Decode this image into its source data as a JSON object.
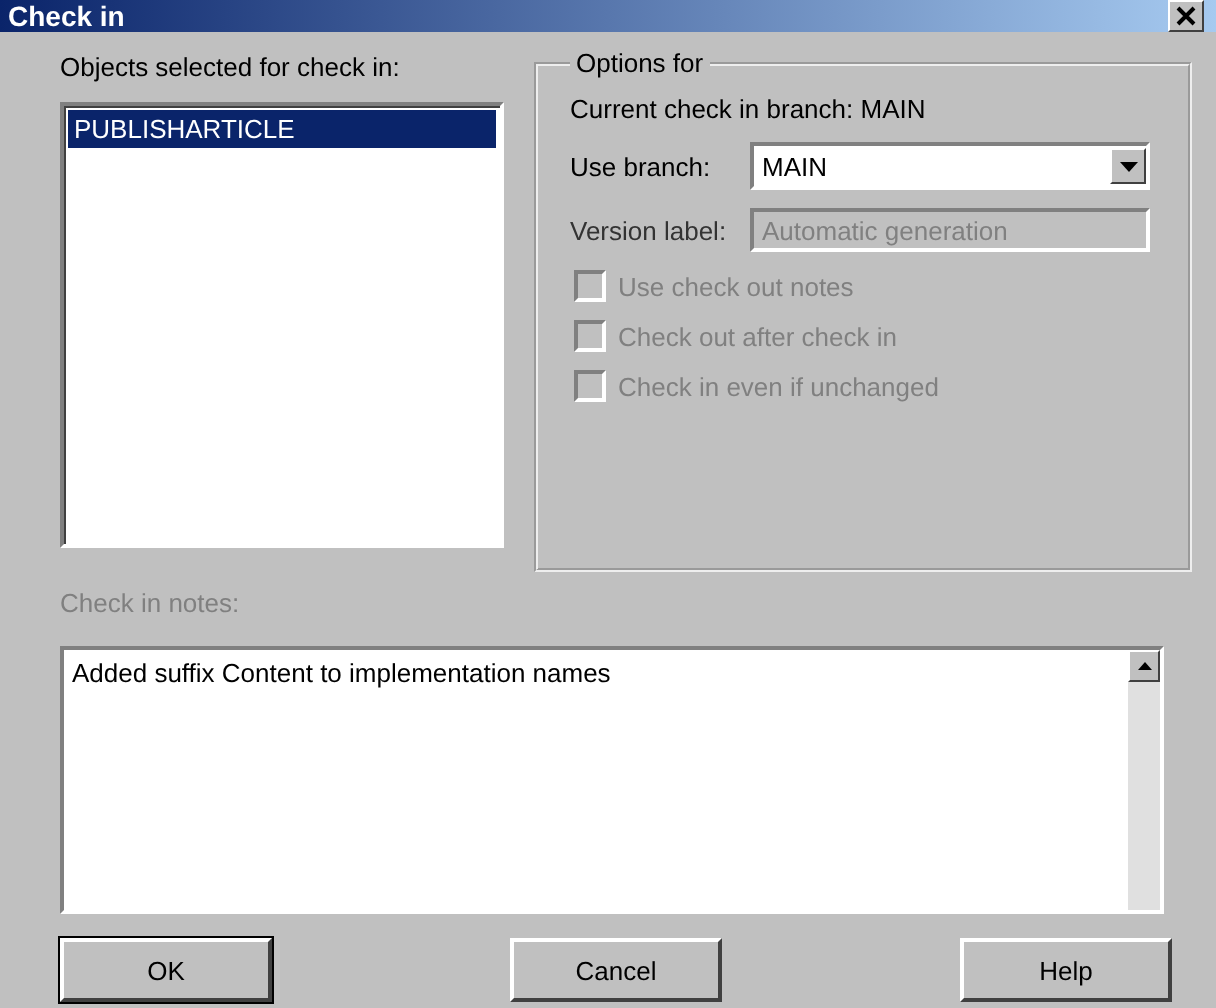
{
  "window": {
    "title": "Check in"
  },
  "objects": {
    "label": "Objects selected for check in:",
    "items": [
      {
        "name": "PUBLISHARTICLE",
        "selected": true
      }
    ]
  },
  "options": {
    "legend": "Options for",
    "current_branch": "Current check in branch: MAIN",
    "branch_label": "Use branch:",
    "branch_value": "MAIN",
    "version_label": "Version label:",
    "version_placeholder": "Automatic generation",
    "version_disabled": true,
    "checkboxes": [
      {
        "label": "Use check out notes",
        "checked": false,
        "disabled": true
      },
      {
        "label": "Check out after check in",
        "checked": false,
        "disabled": true
      },
      {
        "label": "Check in even if unchanged",
        "checked": false,
        "disabled": true
      }
    ]
  },
  "notes": {
    "label": "Check in notes:",
    "value": "Added suffix Content to implementation names"
  },
  "buttons": [
    "OK",
    "Cancel",
    "Help"
  ]
}
